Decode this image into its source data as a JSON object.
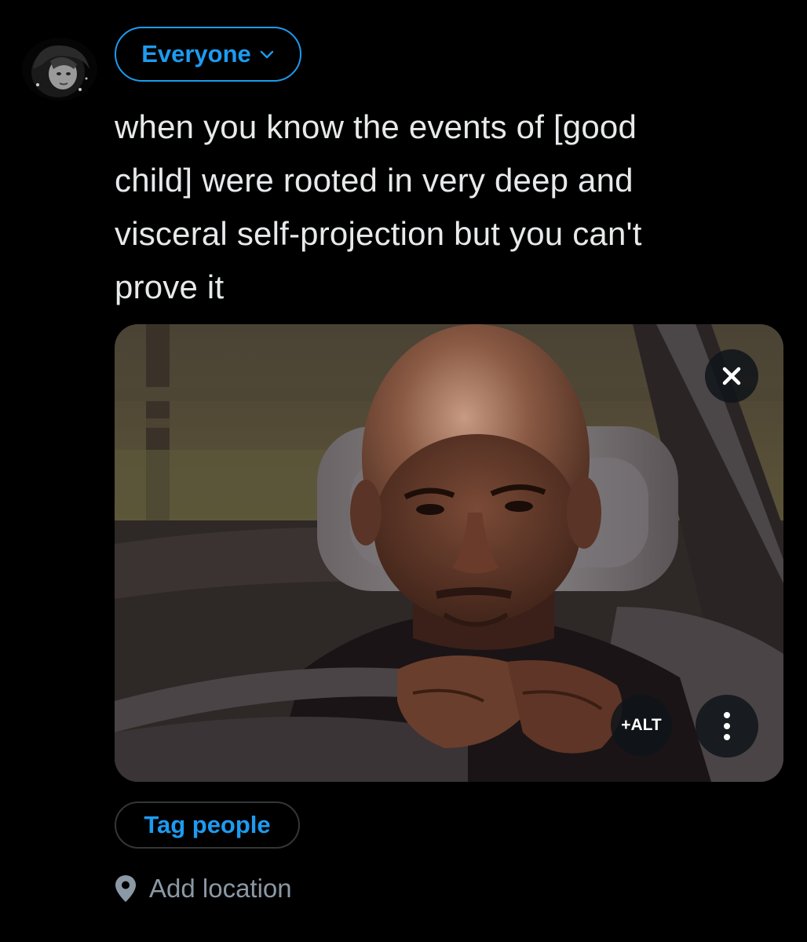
{
  "audience": {
    "label": "Everyone",
    "icon": "chevron-down-icon"
  },
  "composer": {
    "text": "when you know the events of [good\nchild] were rooted in very deep and\nvisceral self-projection but you can't\nprove it"
  },
  "media": {
    "remove_icon": "close-icon",
    "alt_label": "+ALT",
    "more_icon": "more-vertical-icon"
  },
  "tag_people": {
    "label": "Tag people"
  },
  "location": {
    "label": "Add location",
    "icon": "location-pin-icon"
  },
  "colors": {
    "accent": "#1d9bf0",
    "background": "#000000",
    "text": "#e7e9ea",
    "muted": "#8b98a5"
  }
}
